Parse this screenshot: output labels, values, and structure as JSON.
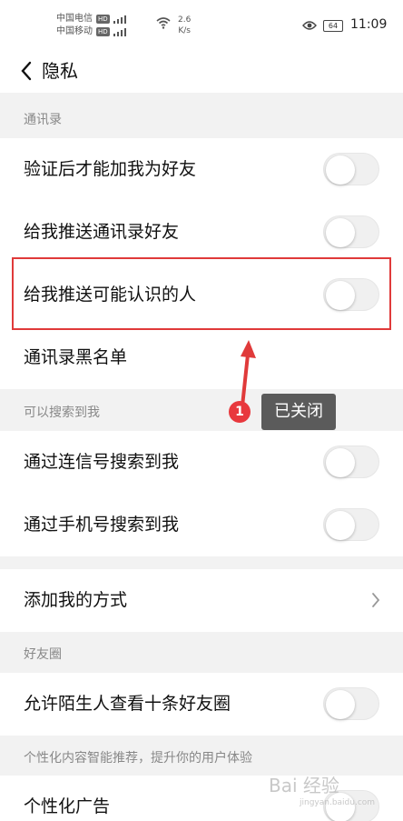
{
  "status_bar": {
    "carrier1": "中国电信",
    "carrier2": "中国移动",
    "hd": "HD",
    "net_speed_value": "2.6",
    "net_speed_unit": "K/s",
    "battery": "64",
    "time": "11:09"
  },
  "header": {
    "title": "隐私"
  },
  "sections": {
    "contacts": "通讯录",
    "searchable": "可以搜索到我",
    "moments": "好友圈",
    "personalization": "个性化内容智能推荐，提升你的用户体验"
  },
  "rows": {
    "verify_friend": {
      "label": "验证后才能加我为好友",
      "enabled": false
    },
    "push_contacts": {
      "label": "给我推送通讯录好友",
      "enabled": false
    },
    "push_maybe_know": {
      "label": "给我推送可能认识的人",
      "enabled": false
    },
    "blacklist": {
      "label": "通讯录黑名单"
    },
    "search_by_id": {
      "label": "通过连信号搜索到我",
      "enabled": false
    },
    "search_by_phone": {
      "label": "通过手机号搜索到我",
      "enabled": false
    },
    "add_methods": {
      "label": "添加我的方式"
    },
    "stranger_moments": {
      "label": "允许陌生人查看十条好友圈",
      "enabled": false
    },
    "personal_ads": {
      "label": "个性化广告",
      "enabled": false
    }
  },
  "annotation": {
    "step": "1",
    "tip": "已关闭",
    "color": "#e03a3a"
  },
  "watermark": {
    "text": "Bai 经验",
    "sub": "jingyan.baidu.com"
  }
}
